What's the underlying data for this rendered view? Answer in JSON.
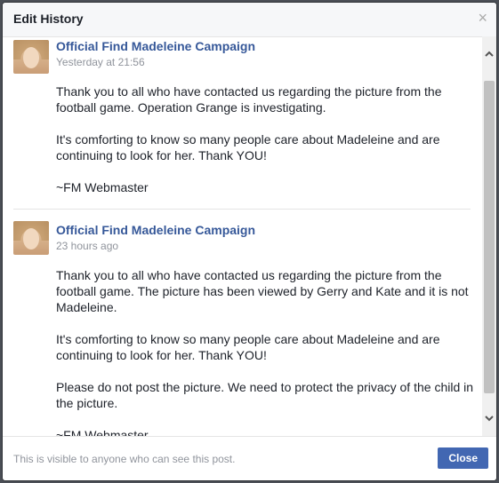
{
  "dialog": {
    "title": "Edit History",
    "close_symbol": "×"
  },
  "posts": [
    {
      "author": "Official Find Madeleine Campaign",
      "time": "Yesterday at 21:56",
      "paragraphs": [
        "Thank you to all who have contacted us regarding the picture from the football game. Operation Grange is investigating.",
        "It's comforting to know so many people care about Madeleine and are continuing to look for her. Thank YOU!",
        "~FM Webmaster"
      ]
    },
    {
      "author": "Official Find Madeleine Campaign",
      "time": "23 hours ago",
      "paragraphs": [
        "Thank you to all who have contacted us regarding the picture from the football game. The picture has been viewed by Gerry and Kate and it is not Madeleine.",
        "It's comforting to know so many people care about Madeleine and are continuing to look for her. Thank YOU!",
        "Please do not post the picture. We need to protect the privacy of the child in the picture.",
        "~FM Webmaster"
      ]
    }
  ],
  "footer": {
    "visibility_text": "This is visible to anyone who can see this post.",
    "close_label": "Close"
  },
  "icons": {
    "close": "close-icon",
    "scroll_up": "chevron-up-icon",
    "scroll_down": "chevron-down-icon"
  },
  "colors": {
    "link": "#365899",
    "primary_button": "#4267b2"
  }
}
